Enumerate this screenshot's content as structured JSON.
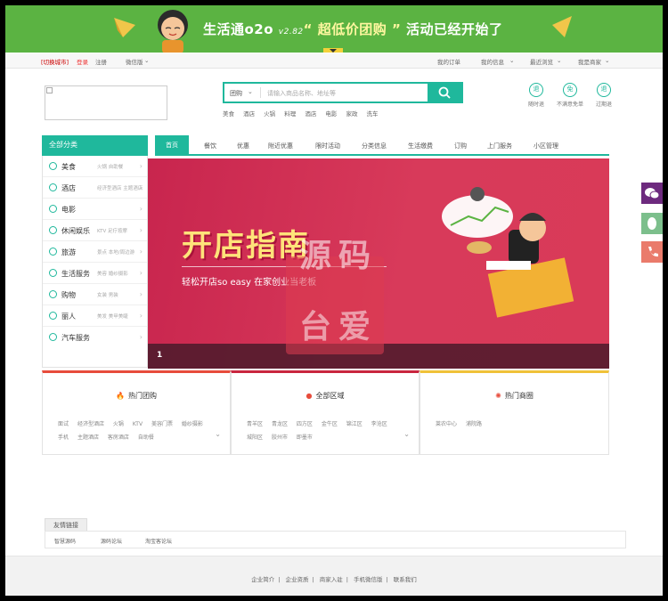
{
  "banner": {
    "title_pre": "生活通o2o ",
    "version": "v2.82",
    "title_quote": "“ 超低价团购 ”",
    "title_post": " 活动已经开始了"
  },
  "topnav": {
    "switch_city": "[切换城市]",
    "login": "登录",
    "register": "注册",
    "weixin": "微信版",
    "my_orders": "我的订单",
    "my_info": "我的信息",
    "recent": "最近浏览",
    "merchant": "我是商家"
  },
  "search": {
    "category": "团购",
    "placeholder": "请输入商品名称、地址等",
    "hotwords": [
      "美食",
      "酒店",
      "火锅",
      "料理",
      "酒店",
      "电影",
      "家政",
      "洗车"
    ]
  },
  "promises": [
    {
      "icon": "退",
      "label": "随时退"
    },
    {
      "icon": "免",
      "label": "不满意免单"
    },
    {
      "icon": "退",
      "label": "过期退"
    }
  ],
  "category": {
    "header": "全部分类",
    "items": [
      {
        "label": "美食",
        "sub": "火锅  自助餐",
        "icon": "food-icon"
      },
      {
        "label": "酒店",
        "sub": "经济型酒店  主题酒店",
        "icon": "hotel-icon"
      },
      {
        "label": "电影",
        "sub": "",
        "icon": "film-icon"
      },
      {
        "label": "休闲娱乐",
        "sub": "KTV  足疗按摩",
        "icon": "leisure-icon"
      },
      {
        "label": "旅游",
        "sub": "景点  本地/周边游",
        "icon": "travel-icon"
      },
      {
        "label": "生活服务",
        "sub": "美容  婚纱摄影",
        "icon": "service-icon"
      },
      {
        "label": "购物",
        "sub": "女装  男装",
        "icon": "shopping-icon"
      },
      {
        "label": "丽人",
        "sub": "美发  美甲美睫",
        "icon": "beauty-icon"
      },
      {
        "label": "汽车服务",
        "sub": "",
        "icon": "car-icon"
      }
    ]
  },
  "mainnav": [
    "首页",
    "餐饮",
    "优惠",
    "附近优惠",
    "限时活动",
    "分类信息",
    "生活缴费",
    "订购",
    "上门服务",
    "小区管理"
  ],
  "hero": {
    "title": "开店指南",
    "subtitle": "轻松开店so easy  在家创业当老板",
    "index": "1",
    "watermark1": "源码",
    "watermark2": "台爱"
  },
  "panels": [
    {
      "title": "热门团购",
      "icon": "fire-icon",
      "items": [
        "面试",
        "经济型酒店",
        "火锅",
        "KTV",
        "美容门票",
        "婚纱摄影",
        "手机",
        "主题酒店",
        "客房酒店",
        "自助餐"
      ]
    },
    {
      "title": "全部区域",
      "icon": "location-icon",
      "items": [
        "青羊区",
        "青龙区",
        "四方区",
        "金牛区",
        "锦江区",
        "李沧区",
        "城阳区",
        "胶州市",
        "即墨市"
      ]
    },
    {
      "title": "热门商圈",
      "icon": "hot-icon",
      "items": [
        "莱农中心",
        "浦院路"
      ]
    }
  ],
  "friend_links": {
    "header": "友情链接",
    "items": [
      "智慧源码",
      "源码论坛",
      "淘宝客论坛"
    ]
  },
  "footer": {
    "links": [
      "企业简介",
      "企业资质",
      "商家入驻",
      "手机微信版",
      "联系我们"
    ]
  },
  "colors": {
    "accent": "#1fb89c",
    "banner": "#5bb342",
    "hero": "#d0304f"
  }
}
